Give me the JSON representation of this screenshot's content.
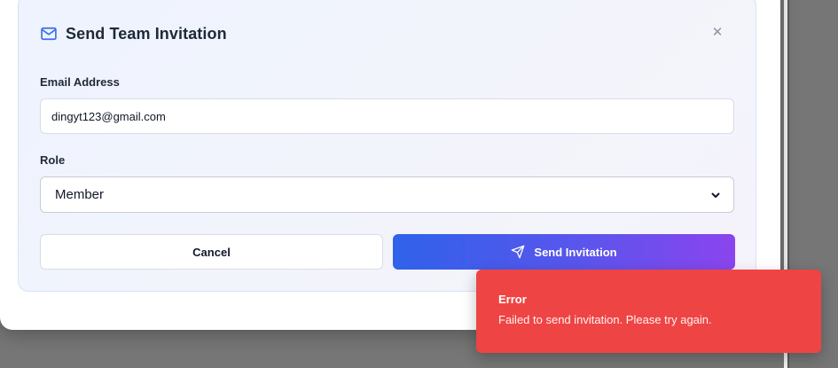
{
  "dialog": {
    "title": "Send Team Invitation",
    "title_icon": "mail-icon",
    "close_icon": "close-icon",
    "close_glyph": "✕"
  },
  "form": {
    "email_label": "Email Address",
    "email_value": "dingyt123@gmail.com",
    "role_label": "Role",
    "role_value": "Member"
  },
  "actions": {
    "cancel_label": "Cancel",
    "send_label": "Send Invitation",
    "send_icon": "send-icon"
  },
  "toast": {
    "title": "Error",
    "message": "Failed to send invitation. Please try again."
  },
  "colors": {
    "accent_start": "#2f62ea",
    "accent_end": "#8b44ee",
    "error": "#ef4444"
  }
}
